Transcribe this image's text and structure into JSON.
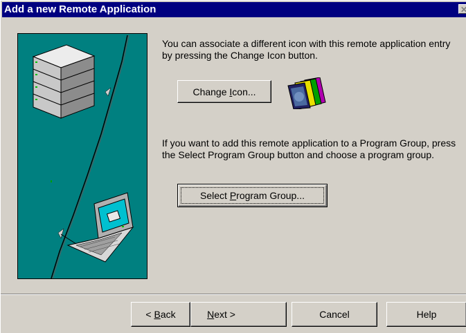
{
  "window": {
    "title": "Add a new Remote Application",
    "close_glyph": "✕"
  },
  "intro_text": "You can associate a different icon with this remote application entry by pressing the Change Icon button.",
  "change_icon": {
    "pre": "Change ",
    "mnemonic": "I",
    "post": "con..."
  },
  "program_group_text": "If you want to add this remote application to a Program Group, press the Select Program Group button and choose a program group.",
  "select_group": {
    "pre": "Select ",
    "mnemonic": "P",
    "post": "rogram Group..."
  },
  "nav": {
    "back": {
      "pre": "< ",
      "mnemonic": "B",
      "post": "ack"
    },
    "next": {
      "pre": "",
      "mnemonic": "N",
      "post": "ext >"
    },
    "cancel": "Cancel",
    "help": "Help"
  },
  "icons": {
    "illustration": "server-laptop-illustration",
    "app_icon": "application-icon-stack",
    "close": "close-icon"
  },
  "colors": {
    "titlebar": "#000080",
    "dialog": "#d4d0c8",
    "illustration_bg": "#008080"
  }
}
